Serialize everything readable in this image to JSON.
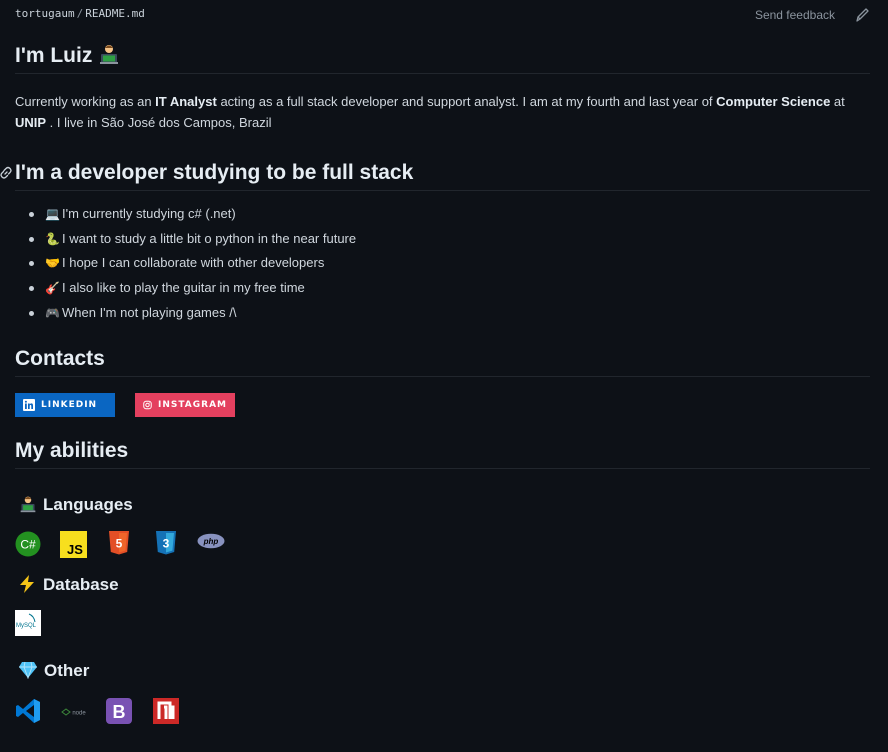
{
  "topbar": {
    "owner": "tortugaum",
    "separator": "/",
    "file": "README.md",
    "feedback_label": "Send feedback",
    "edit_icon": "pencil-icon"
  },
  "intro": {
    "title": "I'm Luiz",
    "title_emoji": "technologist",
    "p1": "Currently working as an ",
    "role": "IT Analyst",
    "p2": " acting as a full stack developer and support analyst. I am at my fourth and last year of ",
    "course": "Computer Science",
    "p3": " at ",
    "school": "UNIP",
    "p4": " . I live in São José dos Campos, Brazil"
  },
  "developer": {
    "heading": "I'm a developer studying to be full stack",
    "items": [
      {
        "emoji": "💻",
        "text": "I'm currently studying c# (.net)"
      },
      {
        "emoji": "🐍",
        "text": "I want to study a little bit o python in the near future"
      },
      {
        "emoji": "🤝",
        "text": "I hope I can collaborate with other developers"
      },
      {
        "emoji": "🎸",
        "text": "I also like to play the guitar in my free time"
      },
      {
        "emoji": "🎮",
        "text": "When I'm not playing games /\\"
      }
    ]
  },
  "contacts": {
    "heading": "Contacts",
    "linkedin": {
      "label": "LINKEDIN",
      "color": "#0a66c2",
      "icon": "linkedin-icon"
    },
    "instagram": {
      "label": "INSTAGRAM",
      "color": "#e4405f",
      "icon": "instagram-icon"
    }
  },
  "abilities": {
    "heading": "My abilities",
    "languages_heading": "Languages",
    "languages": [
      {
        "name": "csharp",
        "label": "C#",
        "color": "#239120"
      },
      {
        "name": "javascript",
        "label": "JS",
        "color": "#f7df1e"
      },
      {
        "name": "html5",
        "label": "5",
        "color": "#e34f26"
      },
      {
        "name": "css3",
        "label": "3",
        "color": "#1572b6"
      },
      {
        "name": "php",
        "label": "php",
        "color": "#777bb4"
      }
    ],
    "database_heading": "Database",
    "database": [
      {
        "name": "mysql",
        "label": "MySQL"
      }
    ],
    "other_heading": "Other",
    "other": [
      {
        "name": "visual-studio-code",
        "color": "#007acc"
      },
      {
        "name": "nodejs",
        "label": "node"
      },
      {
        "name": "bootstrap",
        "label": "B",
        "color": "#7952b3"
      },
      {
        "name": "netlify",
        "color": "#cc2927"
      }
    ]
  }
}
